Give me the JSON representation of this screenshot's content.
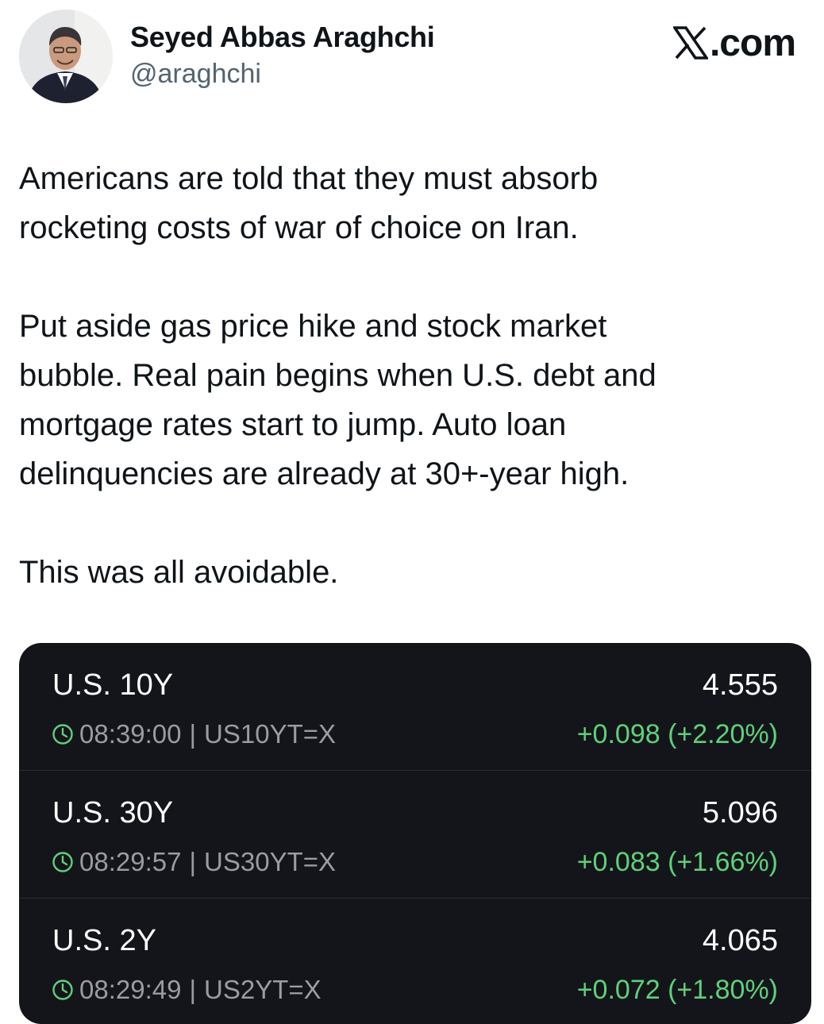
{
  "author": {
    "name": "Seyed Abbas Araghchi",
    "handle": "@araghchi",
    "avatar_icon": "profile-photo"
  },
  "site": {
    "label": ".com",
    "logo_icon": "x-logo-icon"
  },
  "tweet": {
    "paragraphs": [
      "Americans are told that they must absorb\nrocketing costs of war of choice on Iran.",
      "Put aside gas price hike and stock market\nbubble. Real pain begins when U.S. debt and\nmortgage rates start to jump. Auto loan\ndelinquencies are already at 30+-year high.",
      "This was all avoidable."
    ]
  },
  "quotes": [
    {
      "name": "U.S. 10Y",
      "time": "08:39:00",
      "ticker": "US10YT=X",
      "price": "4.555",
      "change": "+0.098 (+2.20%)"
    },
    {
      "name": "U.S. 30Y",
      "time": "08:29:57",
      "ticker": "US30YT=X",
      "price": "5.096",
      "change": "+0.083 (+1.66%)"
    },
    {
      "name": "U.S. 2Y",
      "time": "08:29:49",
      "ticker": "US2YT=X",
      "price": "4.065",
      "change": "+0.072 (+1.80%)"
    }
  ],
  "separator": "|",
  "colors": {
    "card_bg": "#14151a",
    "positive": "#5fd07a",
    "muted": "#9a9ca3",
    "handle": "#536471"
  }
}
